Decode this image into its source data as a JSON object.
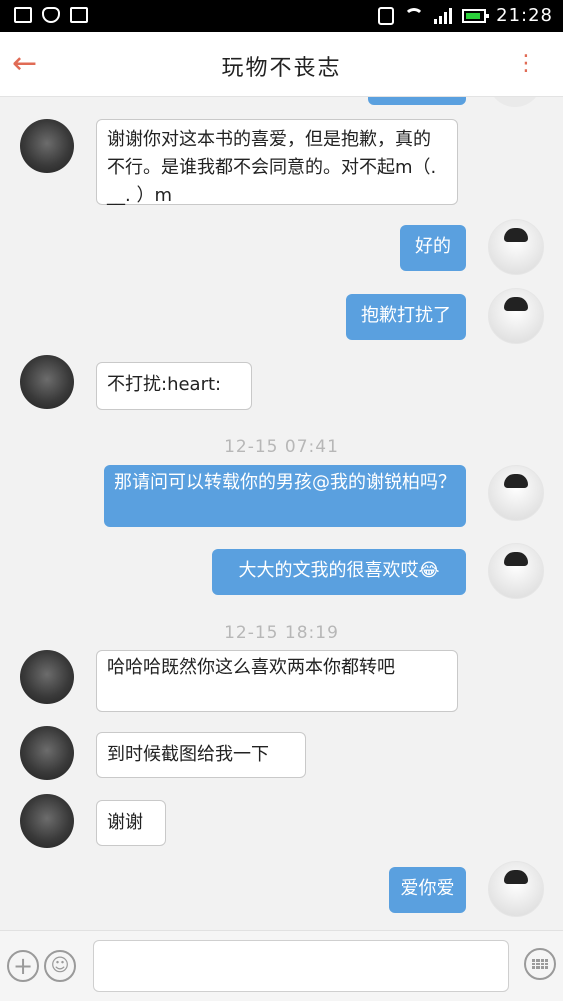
{
  "status_bar": {
    "time": "21:28",
    "icons": [
      "image-icon",
      "shield-icon",
      "plus-square-icon",
      "silent-icon",
      "wifi-icon",
      "signal-icon",
      "battery-icon"
    ]
  },
  "header": {
    "title": "玩物不丧志",
    "back_icon": "arrow-left-icon",
    "more_icon": "more-vertical-icon",
    "accent": "#e06b55"
  },
  "chat": {
    "messages": [
      {
        "from": "other",
        "text": "谢谢你对这本书的喜爱，但是抱歉，真的不行。是谁我都不会同意的。对不起m（. __. ）m"
      },
      {
        "from": "me",
        "text": "好的"
      },
      {
        "from": "me",
        "text": "抱歉打扰了"
      },
      {
        "from": "other",
        "text": "不打扰:heart:"
      },
      {
        "type": "time",
        "text": "12-15 07:41"
      },
      {
        "from": "me",
        "text": "那请问可以转载你的男孩@我的谢锐柏吗？"
      },
      {
        "from": "me",
        "text": "大大的文我的很喜欢哎😂"
      },
      {
        "type": "time",
        "text": "12-15 18:19"
      },
      {
        "from": "other",
        "text": "哈哈哈既然你这么喜欢两本你都转吧"
      },
      {
        "from": "other",
        "text": "到时候截图给我一下"
      },
      {
        "from": "other",
        "text": "谢谢"
      },
      {
        "from": "me",
        "text": "爱你爱"
      }
    ],
    "colors": {
      "me_bubble": "#5aa0df",
      "other_bubble": "#ffffff",
      "time": "#b7b7b7"
    }
  },
  "input_bar": {
    "plus_icon": "plus-circle-icon",
    "emoji_icon": "smile-icon",
    "keyboard_icon": "keyboard-icon",
    "text_value": ""
  }
}
